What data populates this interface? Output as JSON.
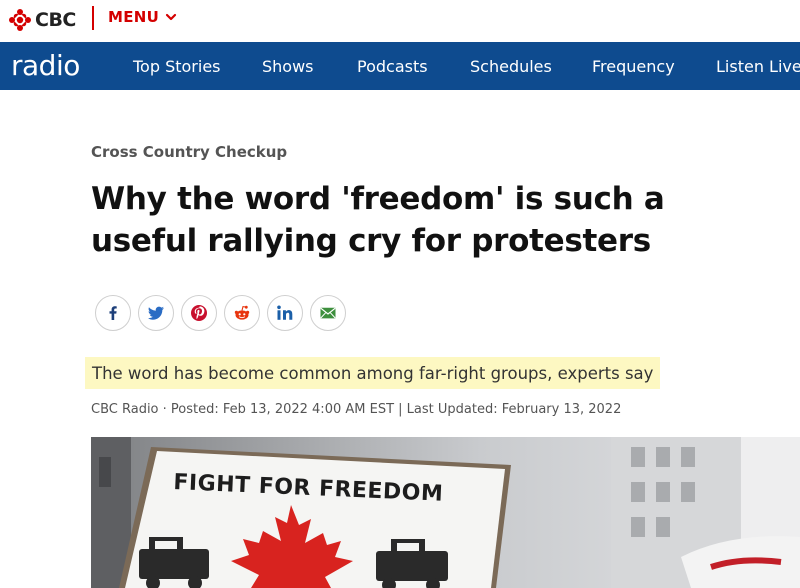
{
  "brand": {
    "logo_text": "CBC",
    "menu_label": "MENU",
    "radio_label": "radio",
    "colors": {
      "brand_red": "#d40000",
      "nav_blue": "#0e4b8f",
      "highlight": "#fdf8c2"
    }
  },
  "nav": {
    "items": [
      {
        "label": "Top Stories"
      },
      {
        "label": "Shows"
      },
      {
        "label": "Podcasts"
      },
      {
        "label": "Schedules"
      },
      {
        "label": "Frequency"
      },
      {
        "label": "Listen Live"
      }
    ]
  },
  "article": {
    "kicker": "Cross Country Checkup",
    "headline": "Why the word 'freedom' is such a useful rallying cry for protesters",
    "deck": "The word has become common among far-right groups, experts say",
    "byline": "CBC Radio · Posted: Feb 13, 2022 4:00 AM EST | Last Updated: February 13, 2022",
    "share_icons": [
      "facebook-icon",
      "twitter-icon",
      "pinterest-icon",
      "reddit-icon",
      "linkedin-icon",
      "email-icon"
    ],
    "photo": {
      "sign_text": "FIGHT FOR FREEDOM"
    }
  }
}
